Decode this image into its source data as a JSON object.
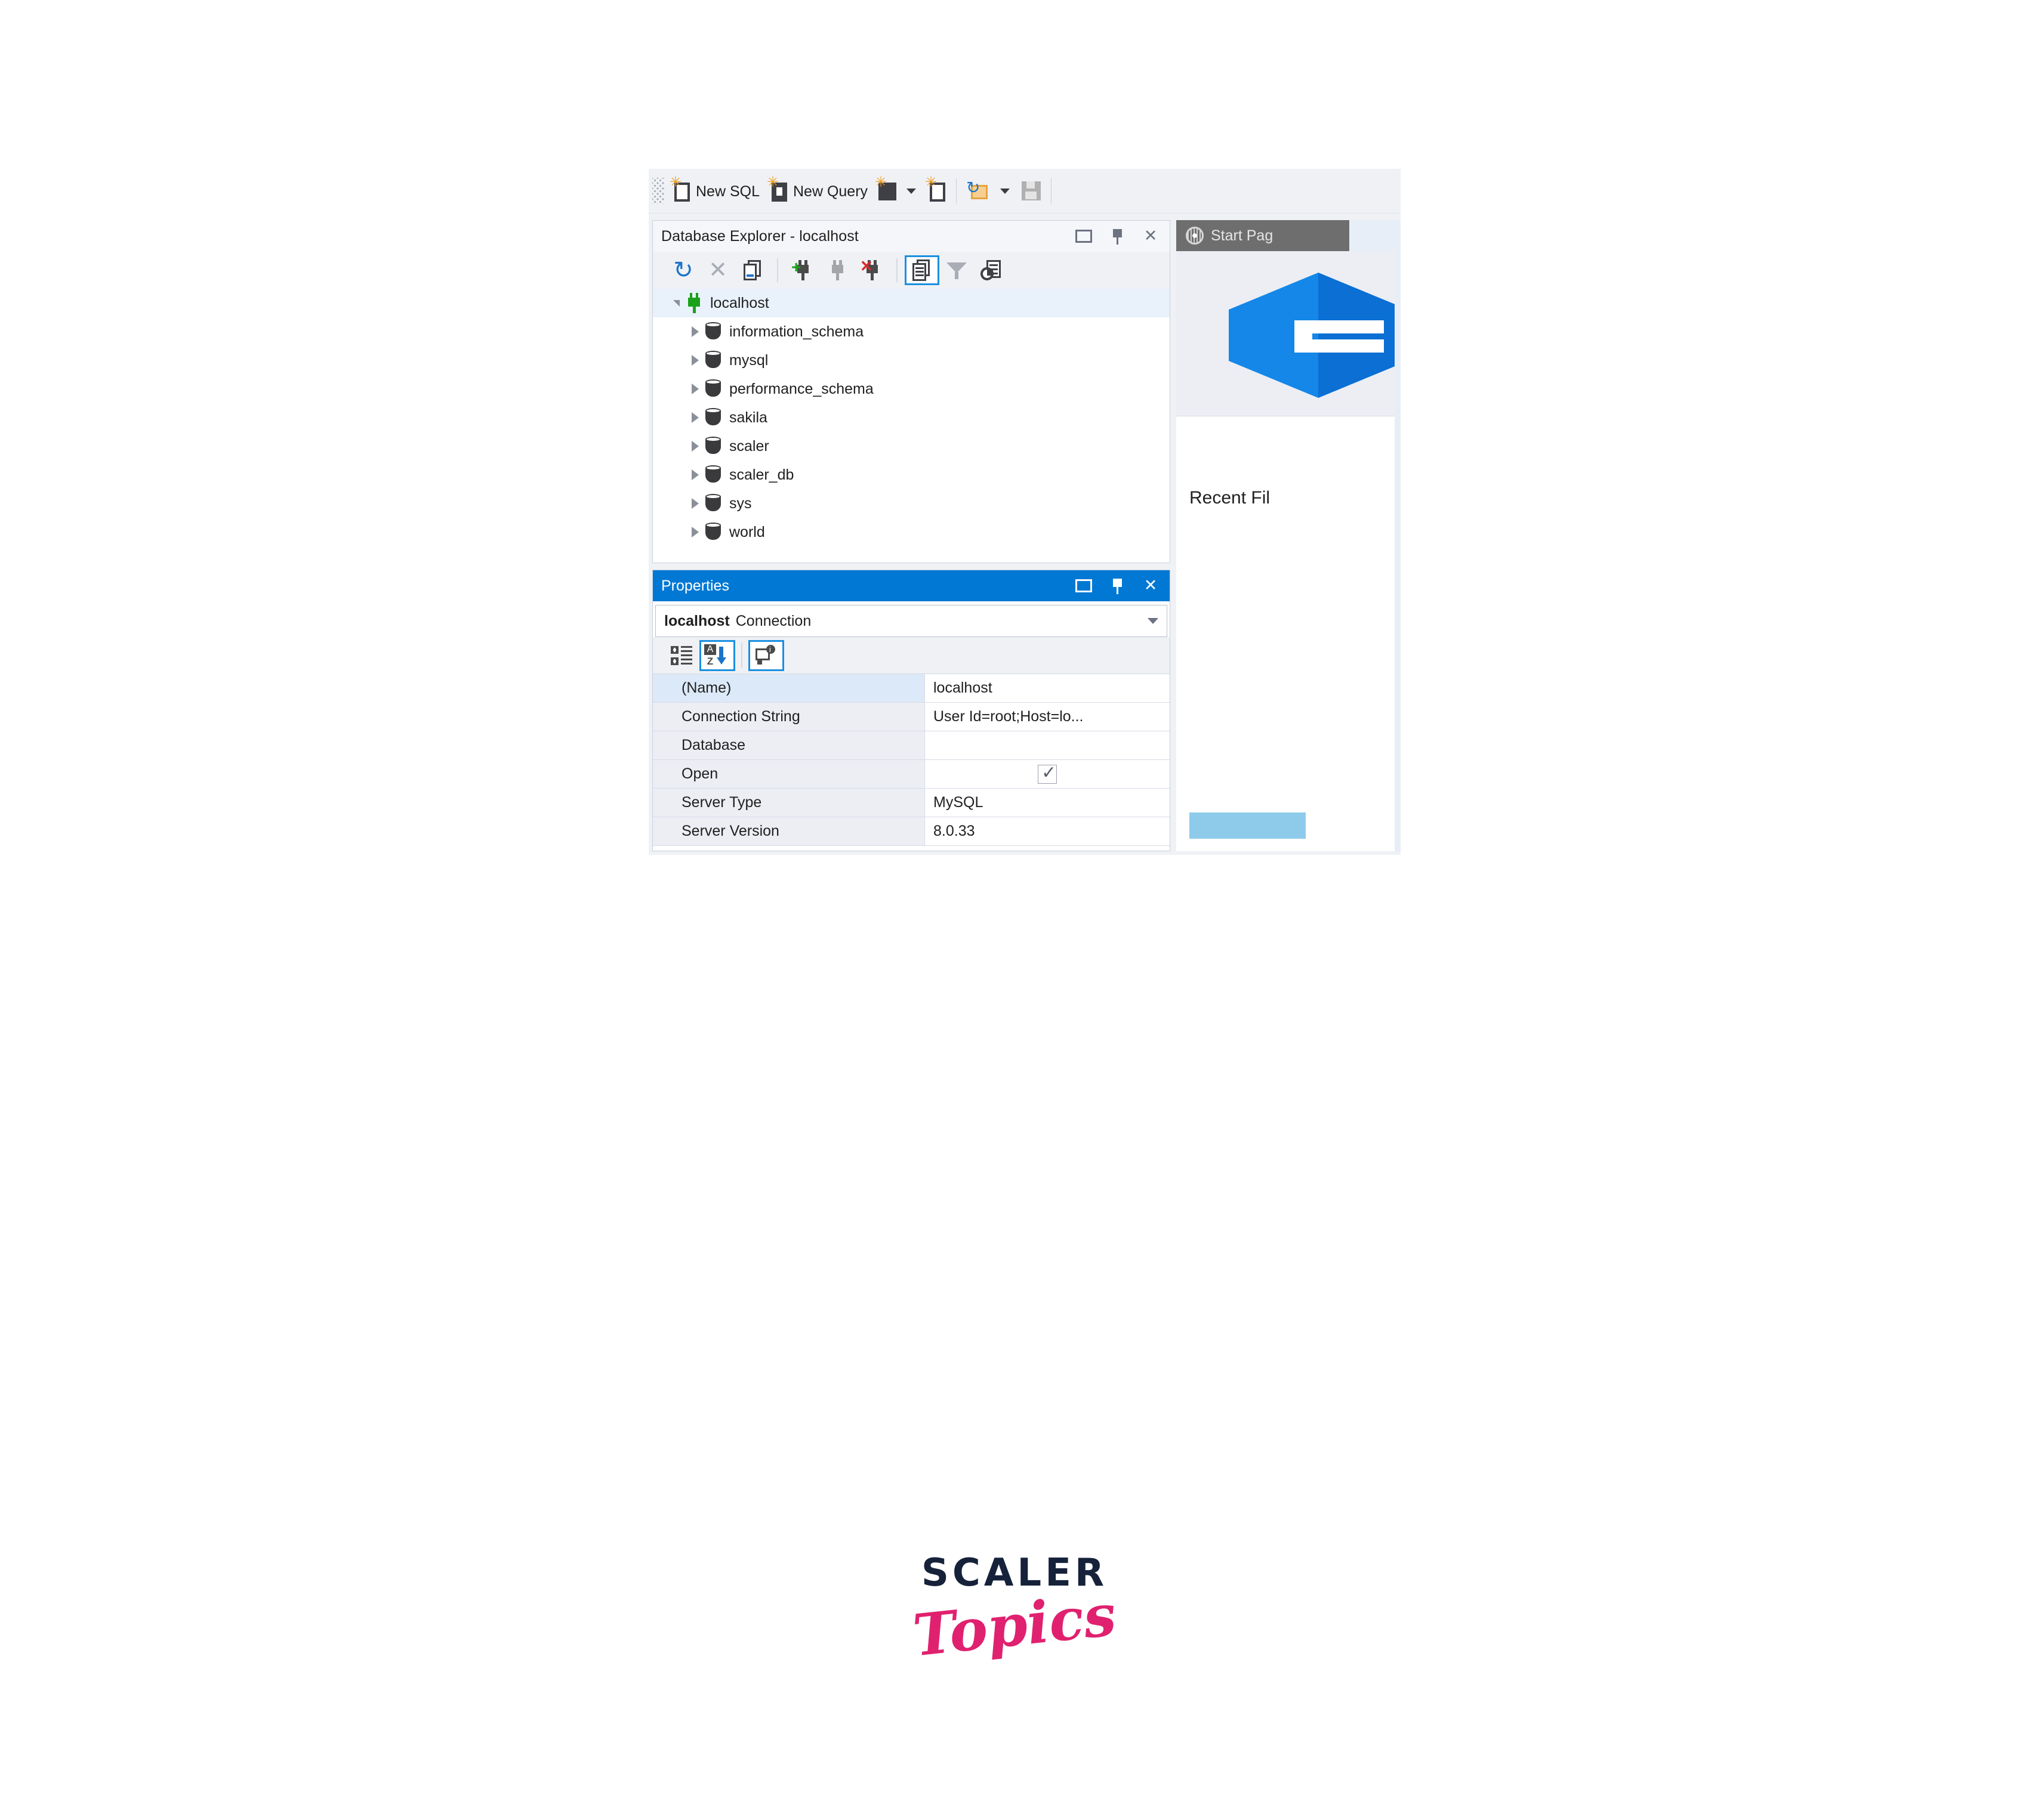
{
  "toolbar": {
    "grip": "toolbar-grip",
    "items": [
      {
        "id": "new-sql",
        "label": "New SQL",
        "icon": "new-sql-icon"
      },
      {
        "id": "new-query",
        "label": "New Query",
        "icon": "new-query-icon"
      },
      {
        "id": "new-object",
        "label": "",
        "icon": "new-object-icon"
      },
      {
        "id": "new-object-dropdown",
        "label": "",
        "icon": "chevron-down-icon"
      },
      {
        "id": "new-file",
        "label": "",
        "icon": "new-file-icon"
      },
      {
        "id": "open-file",
        "label": "",
        "icon": "open-folder-icon"
      },
      {
        "id": "open-dropdown",
        "label": "",
        "icon": "chevron-down-icon"
      },
      {
        "id": "save",
        "label": "",
        "icon": "save-disk-icon"
      }
    ]
  },
  "db_explorer": {
    "title": "Database Explorer - localhost",
    "window_buttons": [
      "maximize-icon",
      "pin-icon",
      "close-icon"
    ],
    "toolbar_icons": [
      "refresh-icon",
      "delete-icon",
      "duplicate-icon",
      "new-connection-icon",
      "disconnect-icon",
      "remove-connection-icon",
      "properties-icon",
      "filter-icon",
      "report-icon"
    ],
    "selected_toolbar_icon": "properties-icon",
    "tree": {
      "root": {
        "label": "localhost",
        "icon": "connected-plug-icon",
        "expanded": true,
        "selected": true
      },
      "children": [
        {
          "label": "information_schema",
          "icon": "database-icon",
          "expanded": false
        },
        {
          "label": "mysql",
          "icon": "database-icon",
          "expanded": false
        },
        {
          "label": "performance_schema",
          "icon": "database-icon",
          "expanded": false
        },
        {
          "label": "sakila",
          "icon": "database-icon",
          "expanded": false
        },
        {
          "label": "scaler",
          "icon": "database-icon",
          "expanded": false
        },
        {
          "label": "scaler_db",
          "icon": "database-icon",
          "expanded": false
        },
        {
          "label": "sys",
          "icon": "database-icon",
          "expanded": false
        },
        {
          "label": "world",
          "icon": "database-icon",
          "expanded": false
        }
      ]
    }
  },
  "properties": {
    "title": "Properties",
    "window_buttons": [
      "maximize-icon",
      "pin-icon",
      "close-icon"
    ],
    "object_selector": {
      "name": "localhost",
      "type": "Connection"
    },
    "toolbar_icons": [
      "categorized-icon",
      "alphabetical-sort-icon",
      "property-pages-icon"
    ],
    "selected_toolbar_icons": [
      "alphabetical-sort-icon",
      "property-pages-icon"
    ],
    "rows": [
      {
        "key": "(Name)",
        "value": "localhost",
        "type": "text",
        "selected": true
      },
      {
        "key": "Connection String",
        "value": "User Id=root;Host=lo...",
        "type": "text",
        "selected": false
      },
      {
        "key": "Database",
        "value": "",
        "type": "text",
        "selected": false
      },
      {
        "key": "Open",
        "value": "",
        "type": "checkbox",
        "checked": true,
        "selected": false
      },
      {
        "key": "Server Type",
        "value": "MySQL",
        "type": "text",
        "selected": false
      },
      {
        "key": "Server Version",
        "value": "8.0.33",
        "type": "text",
        "selected": false
      }
    ]
  },
  "document_area": {
    "tab": {
      "label": "Start Pag",
      "icon": "start-page-globe-icon",
      "active": true
    },
    "logo": "dbforge-hex-logo",
    "recent_files_title": "Recent Fil"
  },
  "brand": {
    "primary": "SCALER",
    "secondary": "Topics"
  },
  "colors": {
    "accent_blue": "#0078d4",
    "select_blue": "#1b8fe0",
    "tree_selection": "#e9f2fb",
    "panel_bg": "#eff1f5",
    "tab_inactive": "#6e6e6e",
    "logo_blue": "#1487e8",
    "brand_navy": "#16213a",
    "brand_pink": "#e0216f",
    "connected_green": "#1aa11a"
  }
}
